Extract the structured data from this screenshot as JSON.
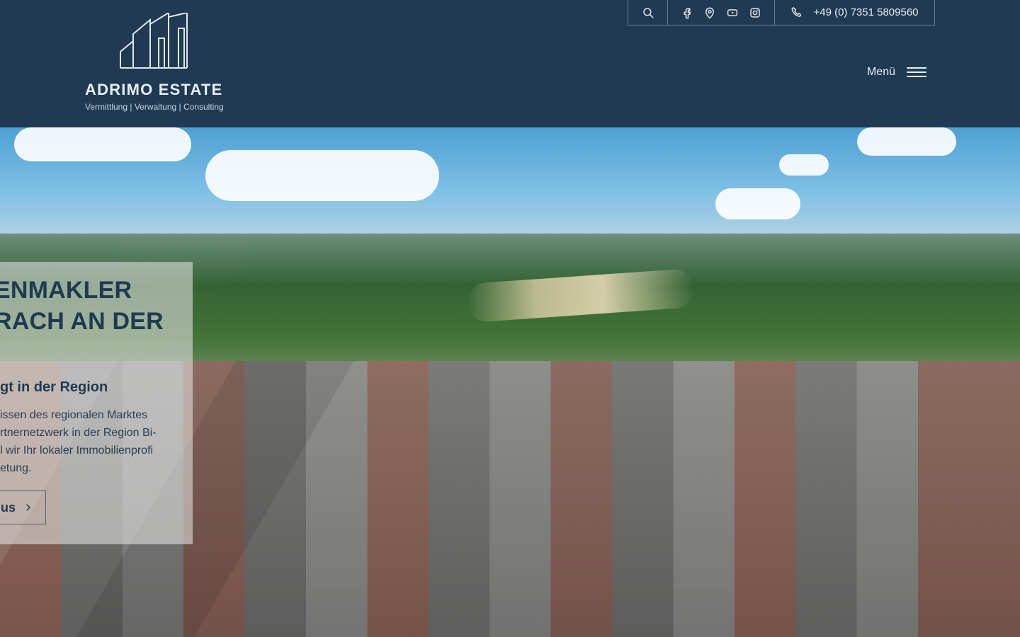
{
  "brand": {
    "name": "ADRIMO ESTATE",
    "tagline": "Vermittlung | Verwaltung | Consulting"
  },
  "topbar": {
    "search_icon": "search-icon",
    "social_icons": [
      "facebook-icon",
      "location-pin-icon",
      "youtube-icon",
      "instagram-icon"
    ],
    "phone_icon": "phone-icon",
    "phone": "+49 (0) 7351 5809560"
  },
  "nav": {
    "menu_label": "Menü",
    "hamburger_icon": "hamburger-icon"
  },
  "hero": {
    "headline_line1": "ENMAKLER",
    "headline_line2": "RACH AN DER",
    "subheadline": "gt in der Region",
    "body_text": "issen des regionalen Marktes\nrtnernetzwerk in der Region Bi-\nl wir Ihr lokaler Immobilienprofi\netung.",
    "cta_label": "us",
    "cta_icon": "chevron-right-icon"
  },
  "colors": {
    "header_bg": "#1f3a52",
    "header_text": "#e7eef5",
    "overlay_bg": "rgba(225,225,225,0.58)",
    "accent_text": "#1f3a52"
  }
}
